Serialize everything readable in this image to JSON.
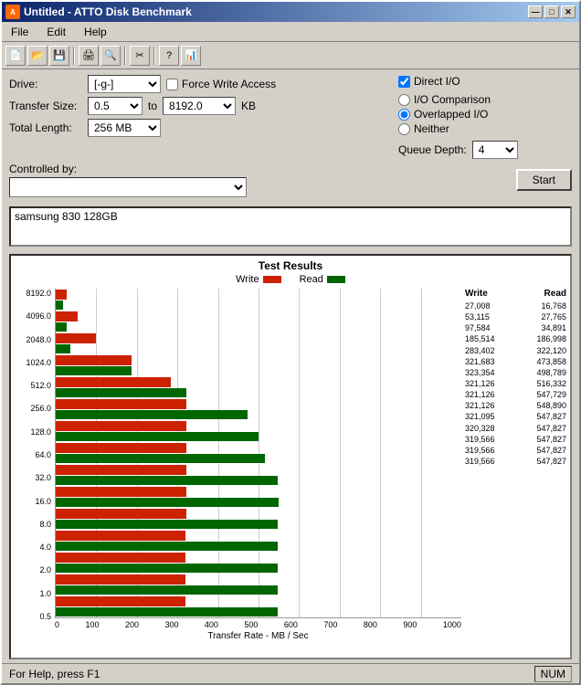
{
  "window": {
    "title": "Untitled - ATTO Disk Benchmark",
    "icon": "A"
  },
  "titlebar": {
    "minimize": "—",
    "maximize": "□",
    "close": "✕"
  },
  "menu": {
    "items": [
      "File",
      "Edit",
      "Help"
    ]
  },
  "toolbar": {
    "buttons": [
      "📄",
      "📂",
      "💾",
      "🖨",
      "🔍",
      "✂",
      "?",
      "📊"
    ]
  },
  "controls": {
    "drive_label": "Drive:",
    "drive_value": "[-g-]",
    "force_write_label": "Force Write Access",
    "direct_io_label": "Direct I/O",
    "transfer_size_label": "Transfer Size:",
    "transfer_from": "0.5",
    "transfer_to_label": "to",
    "transfer_to": "8192.0",
    "transfer_unit": "KB",
    "total_length_label": "Total Length:",
    "total_length": "256 MB",
    "io_comparison": "I/O Comparison",
    "overlapped_io": "Overlapped I/O",
    "neither": "Neither",
    "queue_depth_label": "Queue Depth:",
    "queue_depth": "4",
    "controlled_by_label": "Controlled by:",
    "controlled_by_value": "",
    "start_label": "Start"
  },
  "drive_info": {
    "text": "samsung 830 128GB"
  },
  "chart": {
    "title": "Test Results",
    "write_label": "Write",
    "read_label": "Read",
    "y_labels": [
      "8192.0",
      "4096.0",
      "2048.0",
      "1024.0",
      "512.0",
      "256.0",
      "128.0",
      "64.0",
      "32.0",
      "16.0",
      "8.0",
      "4.0",
      "2.0",
      "1.0",
      "0.5"
    ],
    "x_labels": [
      "0",
      "100",
      "200",
      "300",
      "400",
      "500",
      "600",
      "700",
      "800",
      "900",
      "1000"
    ],
    "x_title": "Transfer Rate - MB / Sec",
    "col_write": "Write",
    "col_read": "Read",
    "max_val": 1000,
    "rows": [
      {
        "label": "0.5",
        "write": 27008,
        "read": 16768,
        "write_pct": 2.7,
        "read_pct": 1.7
      },
      {
        "label": "1.0",
        "write": 53115,
        "read": 27765,
        "write_pct": 5.3,
        "read_pct": 2.8
      },
      {
        "label": "2.0",
        "write": 97584,
        "read": 34891,
        "write_pct": 9.8,
        "read_pct": 3.5
      },
      {
        "label": "4.0",
        "write": 185514,
        "read": 186998,
        "write_pct": 18.6,
        "read_pct": 18.7
      },
      {
        "label": "8.0",
        "write": 283402,
        "read": 322120,
        "write_pct": 28.3,
        "read_pct": 32.2
      },
      {
        "label": "16.0",
        "write": 321683,
        "read": 473858,
        "write_pct": 32.2,
        "read_pct": 47.4
      },
      {
        "label": "32.0",
        "write": 323354,
        "read": 498789,
        "write_pct": 32.3,
        "read_pct": 49.9
      },
      {
        "label": "64.0",
        "write": 321126,
        "read": 516332,
        "write_pct": 32.1,
        "read_pct": 51.6
      },
      {
        "label": "128.0",
        "write": 321126,
        "read": 547729,
        "write_pct": 32.1,
        "read_pct": 54.8
      },
      {
        "label": "256.0",
        "write": 321126,
        "read": 548890,
        "write_pct": 32.1,
        "read_pct": 54.9
      },
      {
        "label": "512.0",
        "write": 321095,
        "read": 547827,
        "write_pct": 32.1,
        "read_pct": 54.8
      },
      {
        "label": "1024.0",
        "write": 320328,
        "read": 547827,
        "write_pct": 32.0,
        "read_pct": 54.8
      },
      {
        "label": "2048.0",
        "write": 319566,
        "read": 547827,
        "write_pct": 32.0,
        "read_pct": 54.8
      },
      {
        "label": "4096.0",
        "write": 319566,
        "read": 547827,
        "write_pct": 32.0,
        "read_pct": 54.8
      },
      {
        "label": "8192.0",
        "write": 319566,
        "read": 547827,
        "write_pct": 32.0,
        "read_pct": 54.8
      }
    ]
  },
  "statusbar": {
    "help_text": "For Help, press F1",
    "num_label": "NUM"
  }
}
